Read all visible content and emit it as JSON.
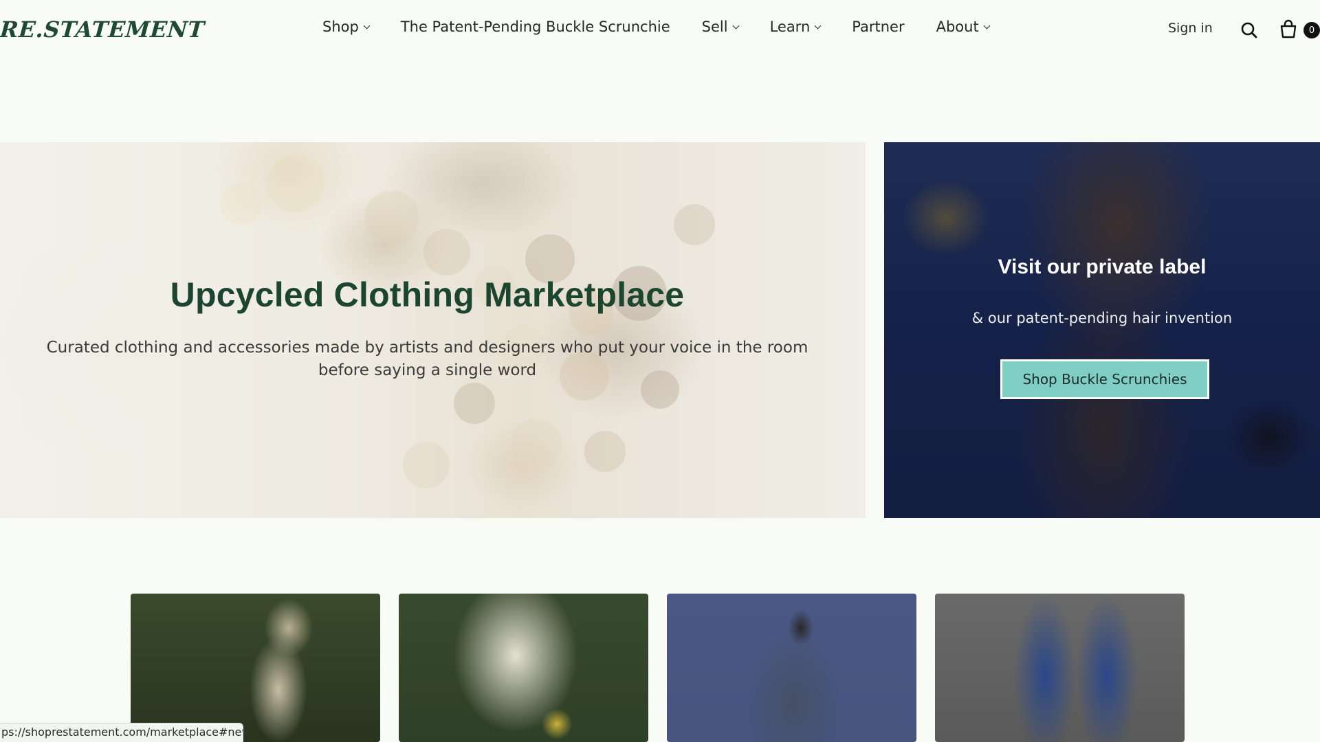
{
  "brand": {
    "logo_text": "RE.STATEMENT"
  },
  "nav": {
    "items": [
      {
        "label": "Shop",
        "has_dropdown": true
      },
      {
        "label": "The Patent-Pending Buckle Scrunchie",
        "has_dropdown": false
      },
      {
        "label": "Sell",
        "has_dropdown": true
      },
      {
        "label": "Learn",
        "has_dropdown": true
      },
      {
        "label": "Partner",
        "has_dropdown": false
      },
      {
        "label": "About",
        "has_dropdown": true
      }
    ],
    "sign_in_label": "Sign in",
    "search_icon": "search-icon",
    "cart_icon": "shopping-bag-icon",
    "cart_count": "0"
  },
  "hero_left": {
    "title": "Upcycled Clothing Marketplace",
    "subtitle": "Curated clothing and accessories made by artists and designers who put your voice in the room before saying a single word"
  },
  "hero_right": {
    "title": "Visit our private label",
    "subtitle": "& our patent-pending hair invention",
    "button_label": "Shop Buckle Scrunchies"
  },
  "products": [
    {
      "image": "woman-in-denim-jacket-forest"
    },
    {
      "image": "white-knit-sweater-forest"
    },
    {
      "image": "patchwork-denim-jacket-back"
    },
    {
      "image": "patched-blue-jeans"
    }
  ],
  "status_bar": {
    "url": "ps://shoprestatement.com/marketplace#new"
  },
  "colors": {
    "brand_green": "#1d4a30",
    "page_bg": "#f8fbf6",
    "button_teal": "#7fcec4"
  }
}
